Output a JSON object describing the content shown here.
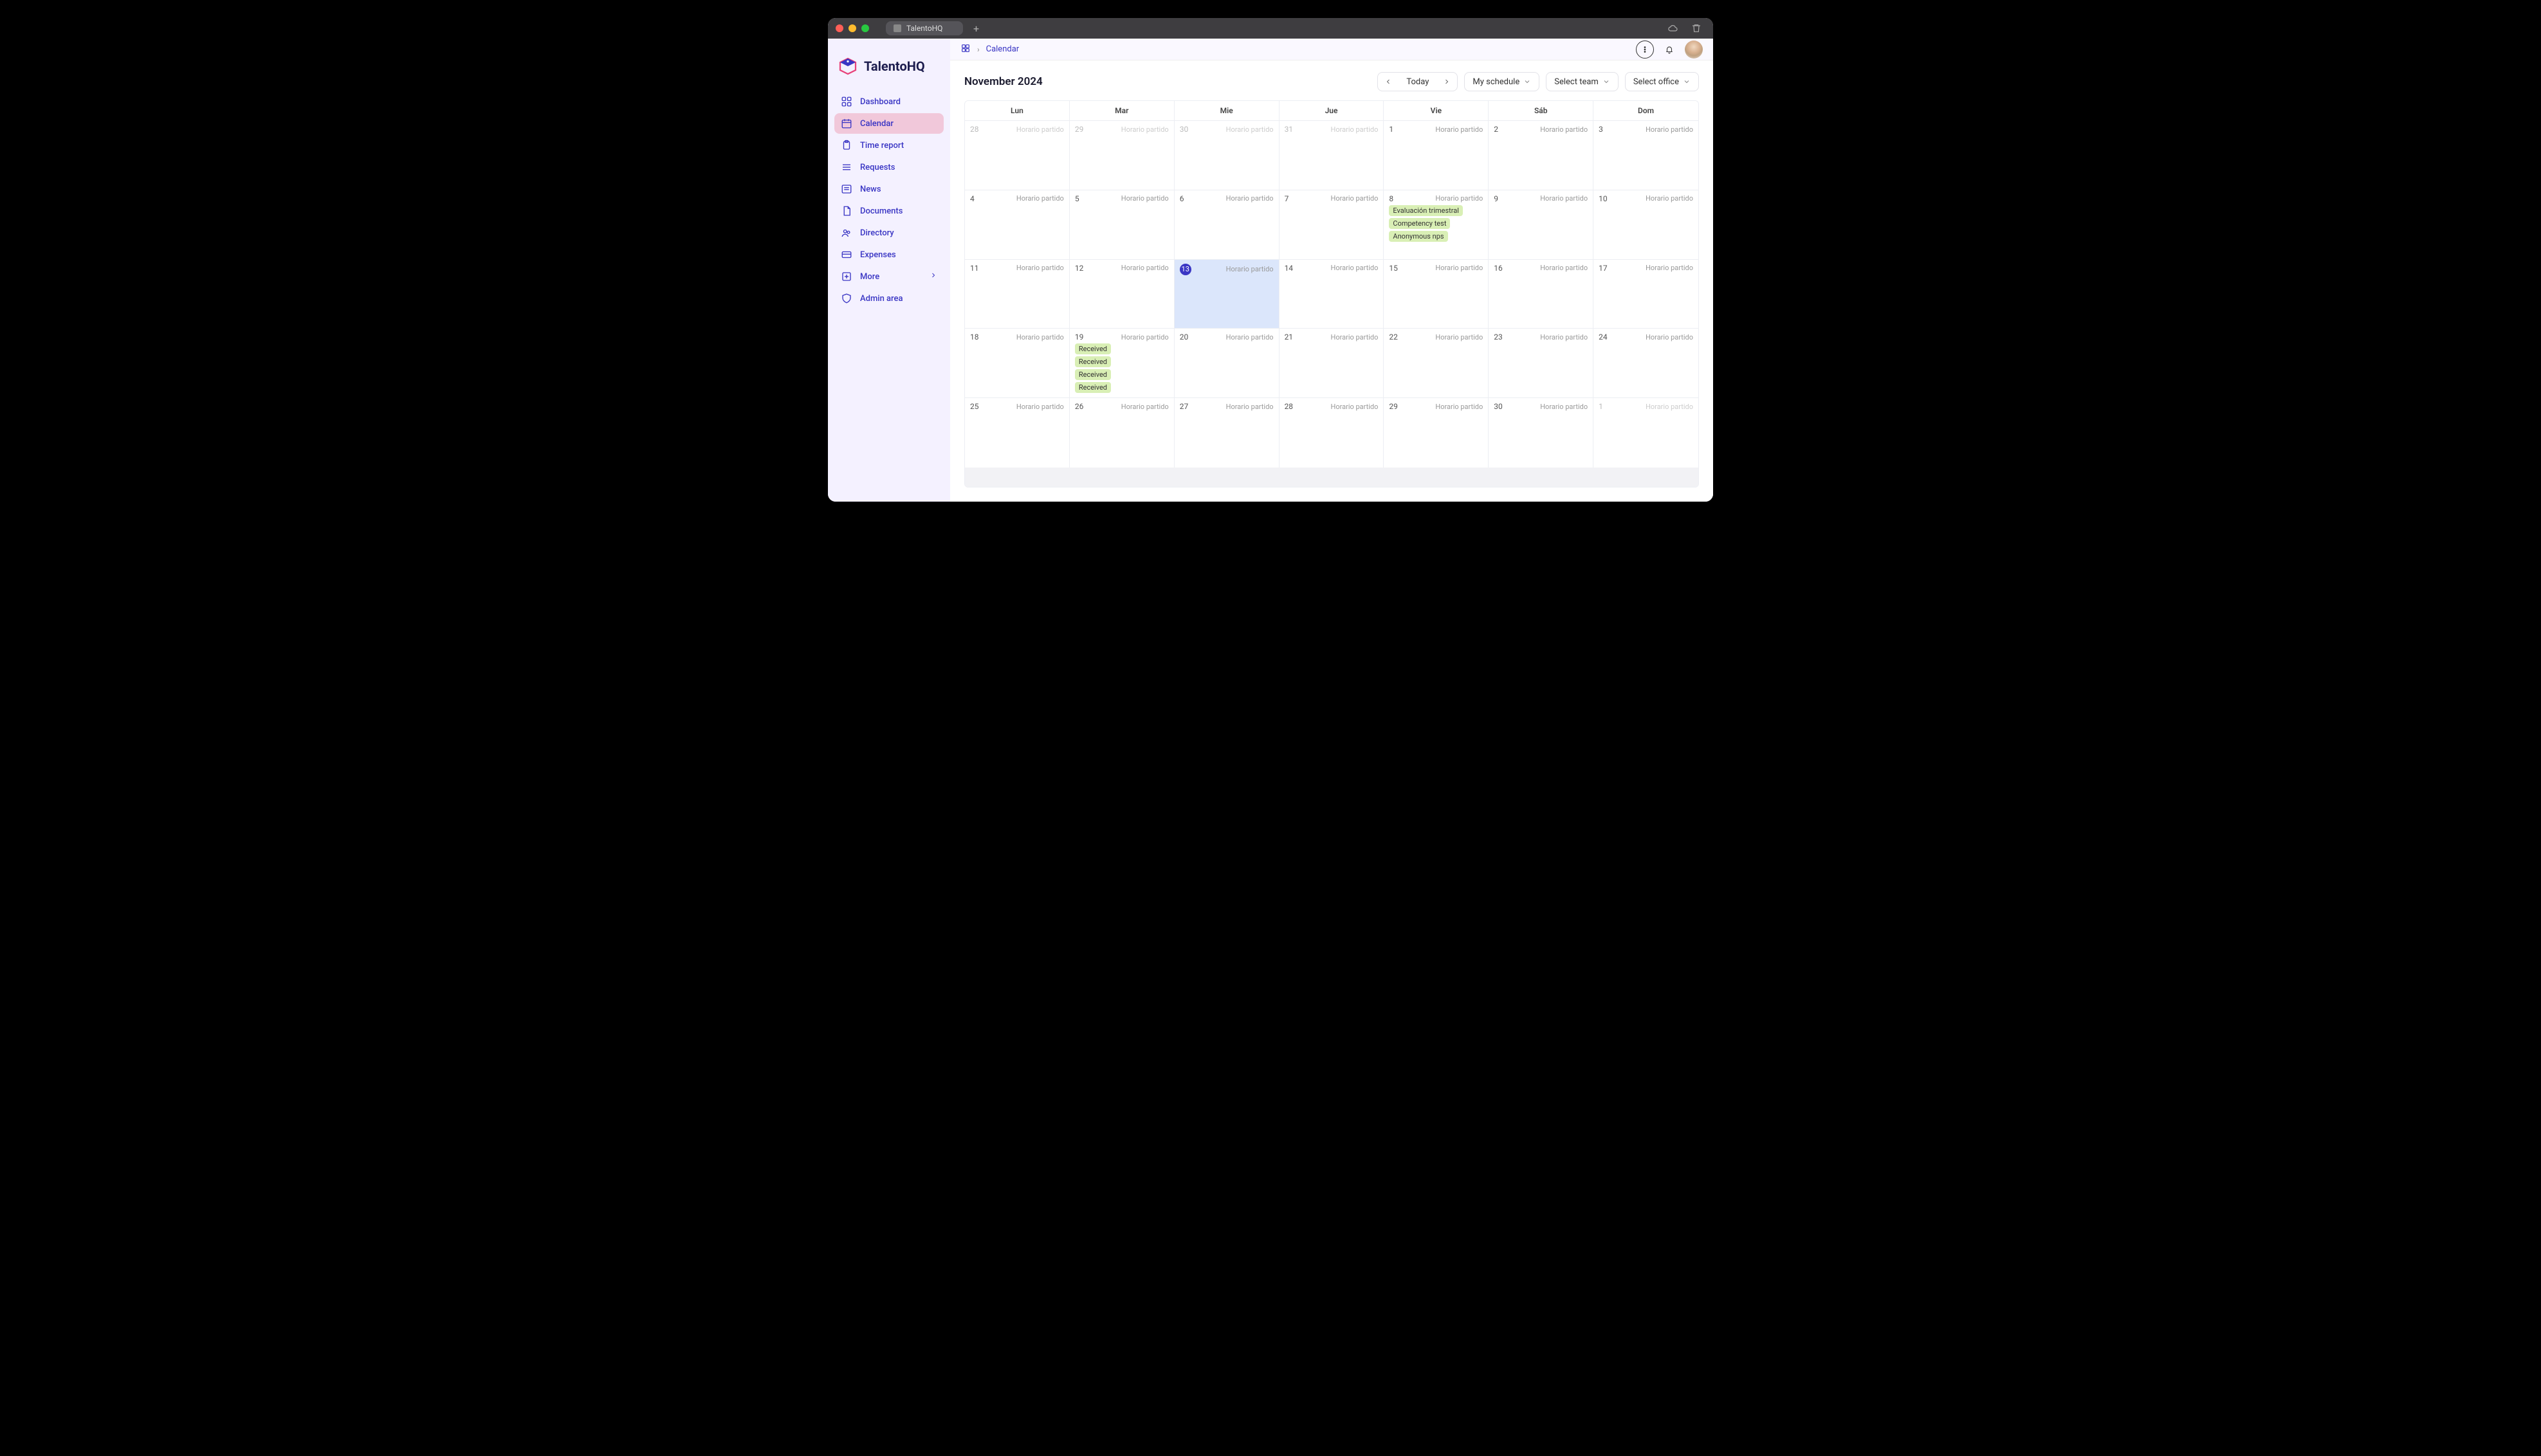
{
  "titlebar": {
    "tab_title": "TalentoHQ"
  },
  "branding": {
    "product_name": "TalentoHQ"
  },
  "breadcrumb": {
    "current": "Calendar"
  },
  "sidebar": {
    "items": [
      {
        "key": "dashboard",
        "label": "Dashboard",
        "icon": "grid-icon",
        "active": false
      },
      {
        "key": "calendar",
        "label": "Calendar",
        "icon": "calendar-icon",
        "active": true
      },
      {
        "key": "timereport",
        "label": "Time report",
        "icon": "clipboard-icon",
        "active": false
      },
      {
        "key": "requests",
        "label": "Requests",
        "icon": "list-icon",
        "active": false
      },
      {
        "key": "news",
        "label": "News",
        "icon": "newspaper-icon",
        "active": false
      },
      {
        "key": "documents",
        "label": "Documents",
        "icon": "file-icon",
        "active": false
      },
      {
        "key": "directory",
        "label": "Directory",
        "icon": "users-icon",
        "active": false
      },
      {
        "key": "expenses",
        "label": "Expenses",
        "icon": "card-icon",
        "active": false
      },
      {
        "key": "more",
        "label": "More",
        "icon": "plus-box-icon",
        "active": false,
        "has_submenu": true
      },
      {
        "key": "admin",
        "label": "Admin area",
        "icon": "shield-icon",
        "active": false
      }
    ]
  },
  "toolbar": {
    "today_label": "Today",
    "schedule_label": "My schedule",
    "team_label": "Select team",
    "office_label": "Select office"
  },
  "calendar": {
    "month_label": "November 2024",
    "shift_label": "Horario partido",
    "today_day": 13,
    "weekdays": [
      "Lun",
      "Mar",
      "Mie",
      "Jue",
      "Vie",
      "Sáb",
      "Dom"
    ],
    "weeks": [
      [
        {
          "day": 28,
          "other_month": true,
          "events": []
        },
        {
          "day": 29,
          "other_month": true,
          "events": []
        },
        {
          "day": 30,
          "other_month": true,
          "events": []
        },
        {
          "day": 31,
          "other_month": true,
          "events": []
        },
        {
          "day": 1,
          "other_month": false,
          "events": []
        },
        {
          "day": 2,
          "other_month": false,
          "events": []
        },
        {
          "day": 3,
          "other_month": false,
          "events": []
        }
      ],
      [
        {
          "day": 4,
          "other_month": false,
          "events": []
        },
        {
          "day": 5,
          "other_month": false,
          "events": []
        },
        {
          "day": 6,
          "other_month": false,
          "events": []
        },
        {
          "day": 7,
          "other_month": false,
          "events": []
        },
        {
          "day": 8,
          "other_month": false,
          "events": [
            "Evaluación trimestral",
            "Competency test",
            "Anonymous nps"
          ]
        },
        {
          "day": 9,
          "other_month": false,
          "events": []
        },
        {
          "day": 10,
          "other_month": false,
          "events": []
        }
      ],
      [
        {
          "day": 11,
          "other_month": false,
          "events": []
        },
        {
          "day": 12,
          "other_month": false,
          "events": []
        },
        {
          "day": 13,
          "other_month": false,
          "events": []
        },
        {
          "day": 14,
          "other_month": false,
          "events": []
        },
        {
          "day": 15,
          "other_month": false,
          "events": []
        },
        {
          "day": 16,
          "other_month": false,
          "events": []
        },
        {
          "day": 17,
          "other_month": false,
          "events": []
        }
      ],
      [
        {
          "day": 18,
          "other_month": false,
          "events": []
        },
        {
          "day": 19,
          "other_month": false,
          "events": [
            "Received",
            "Received",
            "Received",
            "Received"
          ]
        },
        {
          "day": 20,
          "other_month": false,
          "events": []
        },
        {
          "day": 21,
          "other_month": false,
          "events": []
        },
        {
          "day": 22,
          "other_month": false,
          "events": []
        },
        {
          "day": 23,
          "other_month": false,
          "events": []
        },
        {
          "day": 24,
          "other_month": false,
          "events": []
        }
      ],
      [
        {
          "day": 25,
          "other_month": false,
          "events": []
        },
        {
          "day": 26,
          "other_month": false,
          "events": []
        },
        {
          "day": 27,
          "other_month": false,
          "events": []
        },
        {
          "day": 28,
          "other_month": false,
          "events": []
        },
        {
          "day": 29,
          "other_month": false,
          "events": []
        },
        {
          "day": 30,
          "other_month": false,
          "events": []
        },
        {
          "day": 1,
          "other_month": true,
          "events": []
        }
      ]
    ]
  },
  "icons": {
    "grid-icon": "<rect x='3' y='3' width='7' height='7' rx='1.5'/><rect x='14' y='3' width='7' height='7' rx='1.5'/><rect x='3' y='14' width='7' height='7' rx='1.5'/><rect x='14' y='14' width='7' height='7' rx='1.5'/>",
    "calendar-icon": "<rect x='3' y='5' width='18' height='16' rx='2'/><line x1='3' y1='10' x2='21' y2='10'/><line x1='8' y1='3' x2='8' y2='7'/><line x1='16' y1='3' x2='16' y2='7'/>",
    "clipboard-icon": "<rect x='6' y='4' width='12' height='16' rx='2'/><rect x='9' y='2' width='6' height='4' rx='1'/>",
    "list-icon": "<line x1='4' y1='7' x2='20' y2='7'/><line x1='4' y1='12' x2='20' y2='12'/><line x1='4' y1='17' x2='20' y2='17'/>",
    "newspaper-icon": "<rect x='3' y='4' width='18' height='16' rx='2'/><line x1='7' y1='9' x2='17' y2='9'/><line x1='7' y1='13' x2='17' y2='13'/>",
    "file-icon": "<path d='M7 3h8l4 4v14H7z'/><polyline points='15 3 15 7 19 7'/>",
    "users-icon": "<circle cx='9' cy='9' r='3'/><circle cx='16' cy='11' r='2.5'/><path d='M3 20c0-3 3-5 6-5s6 2 6 5'/>",
    "card-icon": "<rect x='3' y='6' width='18' height='12' rx='2'/><line x1='3' y1='11' x2='21' y2='11'/>",
    "plus-box-icon": "<rect x='4' y='4' width='16' height='16' rx='2'/><line x1='12' y1='8' x2='12' y2='16'/><line x1='8' y1='12' x2='16' y2='12'/>",
    "shield-icon": "<path d='M12 3l8 3v5c0 5-3.5 8-8 10-4.5-2-8-5-8-10V6l8-3z'/>"
  }
}
